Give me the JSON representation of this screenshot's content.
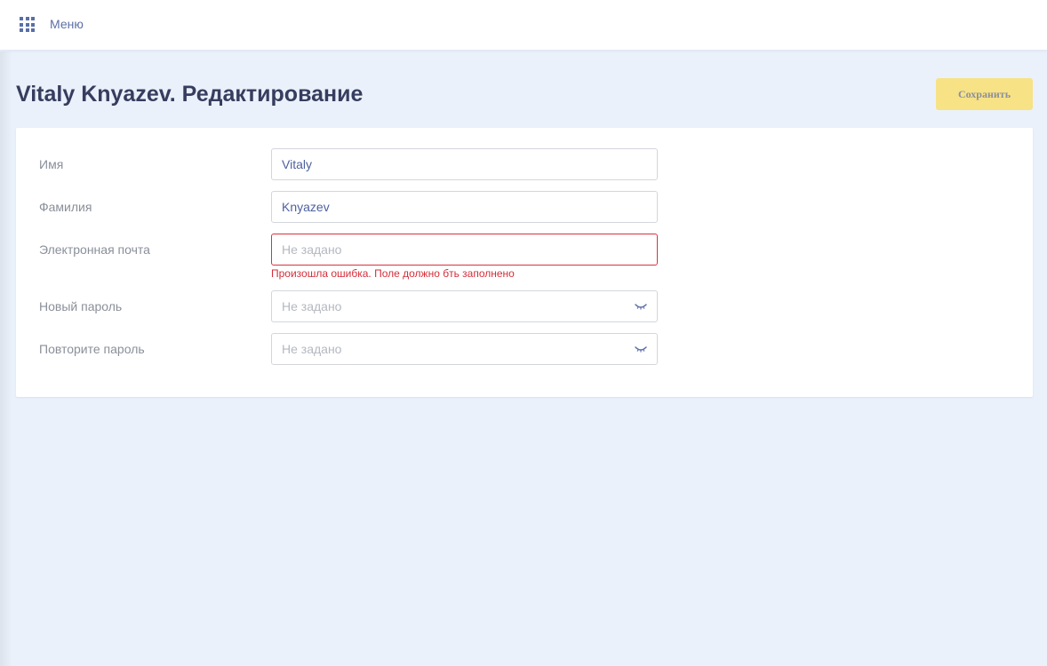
{
  "header": {
    "menu_icon": "grid-icon",
    "menu_label": "Меню"
  },
  "page": {
    "title": "Vitaly Knyazev. Редактирование",
    "save_label": "Сохранить"
  },
  "form": {
    "first_name": {
      "label": "Имя",
      "value": "Vitaly"
    },
    "last_name": {
      "label": "Фамилия",
      "value": "Knyazev"
    },
    "email": {
      "label": "Электронная почта",
      "value": "",
      "placeholder": "Не задано",
      "error": "Произошла ошибка. Поле должно бть заполнено"
    },
    "new_password": {
      "label": "Новый пароль",
      "value": "",
      "placeholder": "Не задано",
      "icon": "eye-closed-icon"
    },
    "repeat_password": {
      "label": "Повторите пароль",
      "value": "",
      "placeholder": "Не задано",
      "icon": "eye-closed-icon"
    }
  },
  "colors": {
    "background": "#eaf1fb",
    "accent_blue": "#4e61a0",
    "title": "#373d5e",
    "save_button": "#f7e286",
    "error": "#d9333c"
  }
}
